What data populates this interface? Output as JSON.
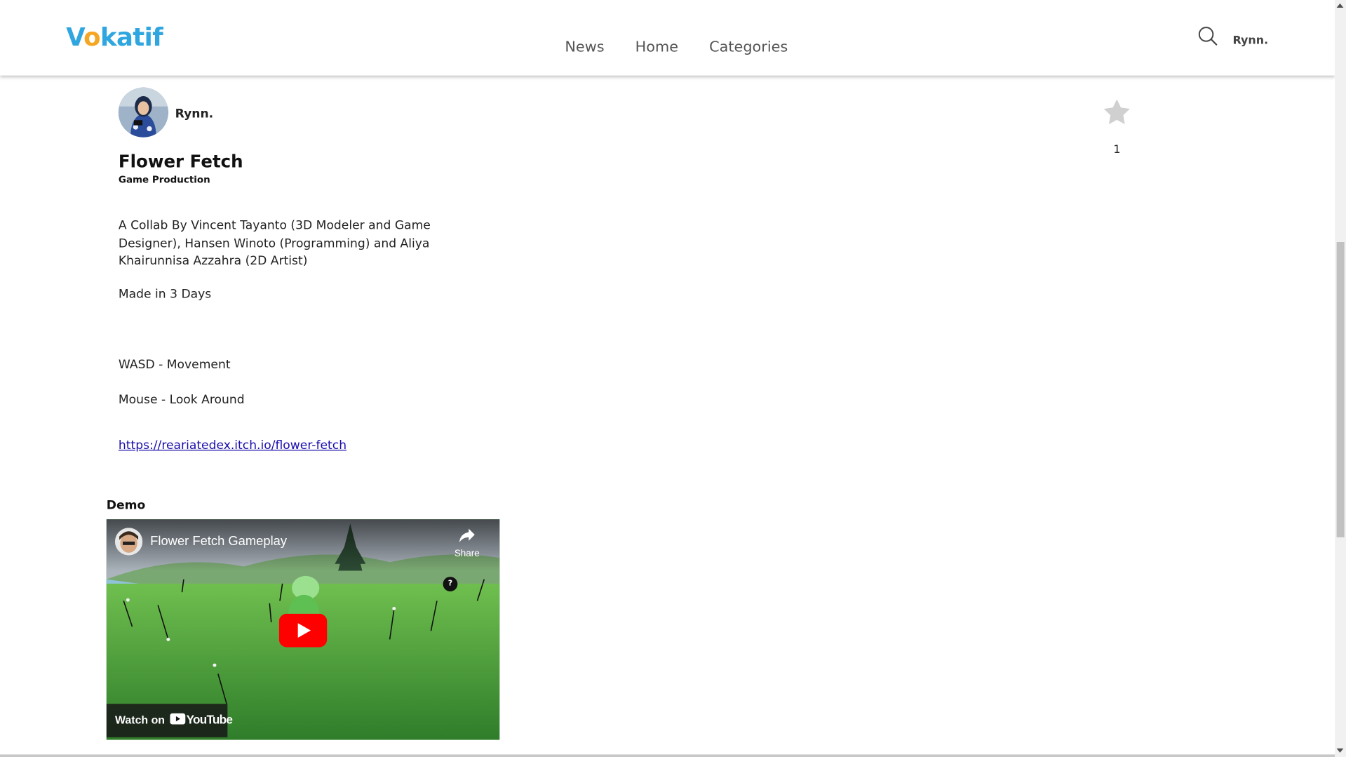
{
  "header": {
    "logo_text": "Vokatif",
    "nav": [
      {
        "label": "News"
      },
      {
        "label": "Home"
      },
      {
        "label": "Categories"
      }
    ],
    "user_name": "Rynn."
  },
  "post": {
    "author": "Rynn.",
    "title": "Flower Fetch",
    "category": "Game Production",
    "description": "A Collab By Vincent Tayanto (3D Modeler and Game Designer), Hansen Winoto (Programming) and Aliya Khairunnisa Azzahra (2D Artist)",
    "made": "Made in 3 Days",
    "controls_move": "WASD - Movement",
    "controls_look": "Mouse - Look Around",
    "link": "https://reariatedex.itch.io/flower-fetch",
    "star_count": "1",
    "demo_label": "Demo"
  },
  "video": {
    "title": "Flower Fetch Gameplay",
    "share_label": "Share",
    "watch_on": "Watch on",
    "youtube": "YouTube",
    "help": "?"
  },
  "colors": {
    "logo_blue": "#2fa6df",
    "logo_orange": "#f5a623",
    "link": "#1a0dab",
    "youtube_red": "#ff0000"
  }
}
